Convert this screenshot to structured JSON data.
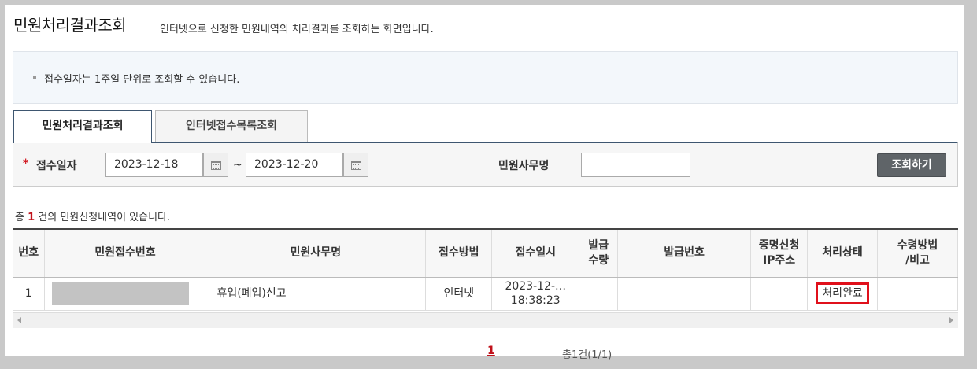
{
  "header": {
    "title": "민원처리결과조회",
    "subtitle": "인터넷으로 신청한 민원내역의 처리결과를 조회하는 화면입니다."
  },
  "notice": {
    "text": "접수일자는 1주일 단위로 조회할 수 있습니다."
  },
  "tabs": [
    {
      "label": "민원처리결과조회",
      "active": true
    },
    {
      "label": "인터넷접수목록조회",
      "active": false
    }
  ],
  "search": {
    "required_mark": "*",
    "date_label": "접수일자",
    "start_date": "2023-12-18",
    "end_date": "2023-12-20",
    "separator": "~",
    "office_label": "민원사무명",
    "office_value": "",
    "submit_label": "조회하기"
  },
  "summary": {
    "prefix": "총 ",
    "count": "1",
    "suffix": " 건의 민원신청내역이 있습니다."
  },
  "table": {
    "columns": [
      "번호",
      "민원접수번호",
      "민원사무명",
      "접수방법",
      "접수일시",
      "발급\n수량",
      "발급번호",
      "증명신청\nIP주소",
      "처리상태",
      "수령방법\n/비고"
    ],
    "rows": [
      {
        "no": "1",
        "receipt_no": "",
        "office_name": "휴업(폐업)신고",
        "method": "인터넷",
        "date_line1": "2023-12-…",
        "date_line2": "18:38:23",
        "qty": "",
        "issue_no": "",
        "ip": "",
        "status": "처리완료",
        "remark": ""
      }
    ]
  },
  "pagination": {
    "current": "1",
    "total_text": "총1건(1/1)"
  },
  "colors": {
    "accent_dark": "#3e5670",
    "highlight_red": "#e0101b",
    "count_red": "#c0111a",
    "button_gray": "#5f6468"
  }
}
